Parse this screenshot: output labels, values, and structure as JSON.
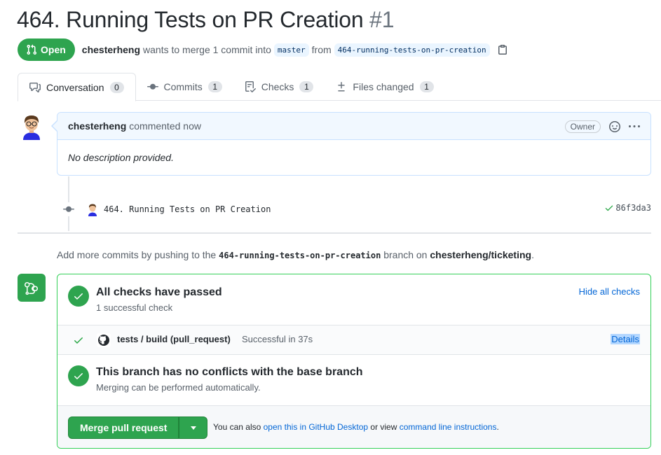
{
  "header": {
    "title": "464. Running Tests on PR Creation",
    "number": "#1",
    "state": "Open",
    "author": "chesterheng",
    "merge_text": "wants to merge 1 commit into",
    "base_branch": "master",
    "from_text": "from",
    "head_branch": "464-running-tests-on-pr-creation"
  },
  "tabs": [
    {
      "label": "Conversation",
      "count": "0"
    },
    {
      "label": "Commits",
      "count": "1"
    },
    {
      "label": "Checks",
      "count": "1"
    },
    {
      "label": "Files changed",
      "count": "1"
    }
  ],
  "comment": {
    "author": "chesterheng",
    "action": "commented now",
    "role": "Owner",
    "body": "No description provided."
  },
  "commit": {
    "message": "464. Running Tests on PR Creation",
    "sha": "86f3da3"
  },
  "push_hint": {
    "prefix": "Add more commits by pushing to the",
    "branch": "464-running-tests-on-pr-creation",
    "middle": "branch on",
    "repo": "chesterheng/ticketing",
    "suffix": "."
  },
  "checks": {
    "title": "All checks have passed",
    "subtitle": "1 successful check",
    "hide_label": "Hide all checks",
    "run_name": "tests / build (pull_request)",
    "run_status": "Successful in 37s",
    "details_label": "Details"
  },
  "conflicts": {
    "title": "This branch has no conflicts with the base branch",
    "subtitle": "Merging can be performed automatically."
  },
  "merge": {
    "button_label": "Merge pull request",
    "hint_prefix": "You can also",
    "desktop_link": "open this in GitHub Desktop",
    "hint_middle": "or view",
    "cli_link": "command line instructions",
    "hint_suffix": "."
  },
  "colors": {
    "success": "#2ea44f",
    "link": "#0366d6"
  }
}
